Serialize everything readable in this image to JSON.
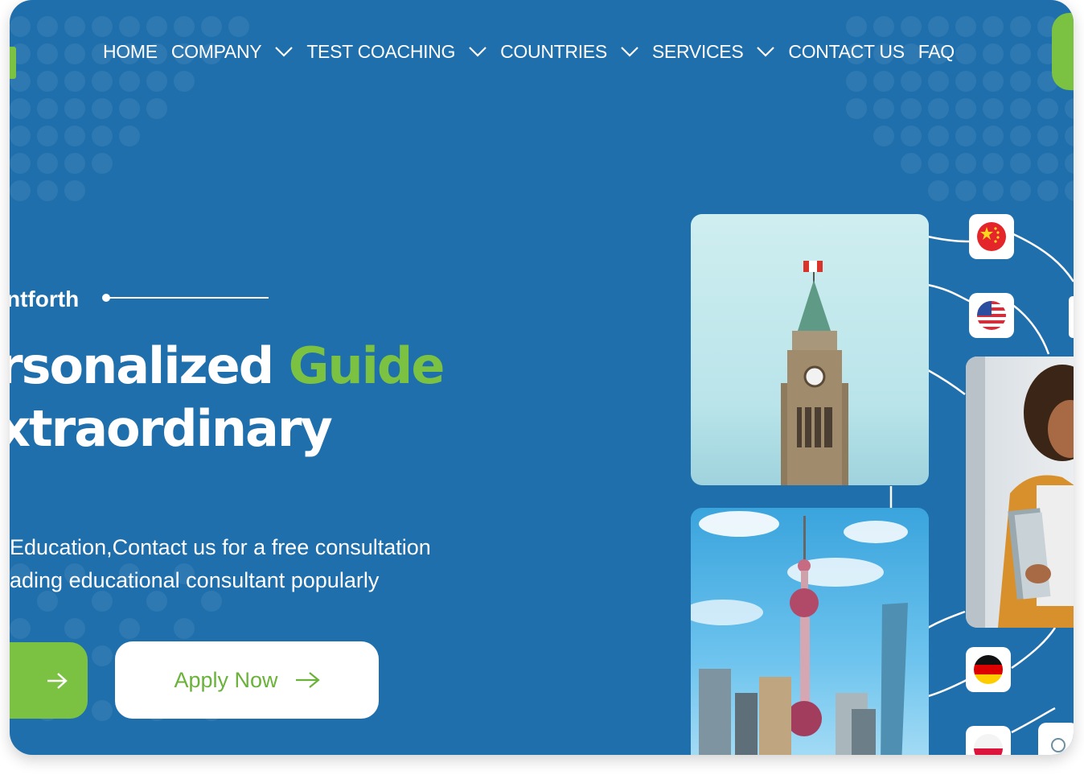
{
  "nav": {
    "items": [
      {
        "label": "HOME",
        "has_dropdown": false
      },
      {
        "label": "COMPANY",
        "has_dropdown": true
      },
      {
        "label": "TEST COACHING",
        "has_dropdown": true
      },
      {
        "label": "COUNTRIES",
        "has_dropdown": true
      },
      {
        "label": "SERVICES",
        "has_dropdown": true
      },
      {
        "label": "CONTACT US",
        "has_dropdown": false
      },
      {
        "label": "FAQ",
        "has_dropdown": false
      }
    ]
  },
  "hero": {
    "tag": "ntforth",
    "headline_line1_white": "rsonalized ",
    "headline_line1_accent": "Guide",
    "headline_line2": "xtraordinary",
    "desc_line1": "Education,Contact us for a free consultation",
    "desc_line2": "ading educational consultant popularly",
    "apply_label": "Apply Now"
  },
  "flags": [
    "china-flag-icon",
    "usa-flag-icon",
    "germany-flag-icon",
    "poland-flag-icon"
  ],
  "colors": {
    "background": "#1f6fad",
    "accent_green": "#7cc242",
    "white": "#ffffff"
  }
}
